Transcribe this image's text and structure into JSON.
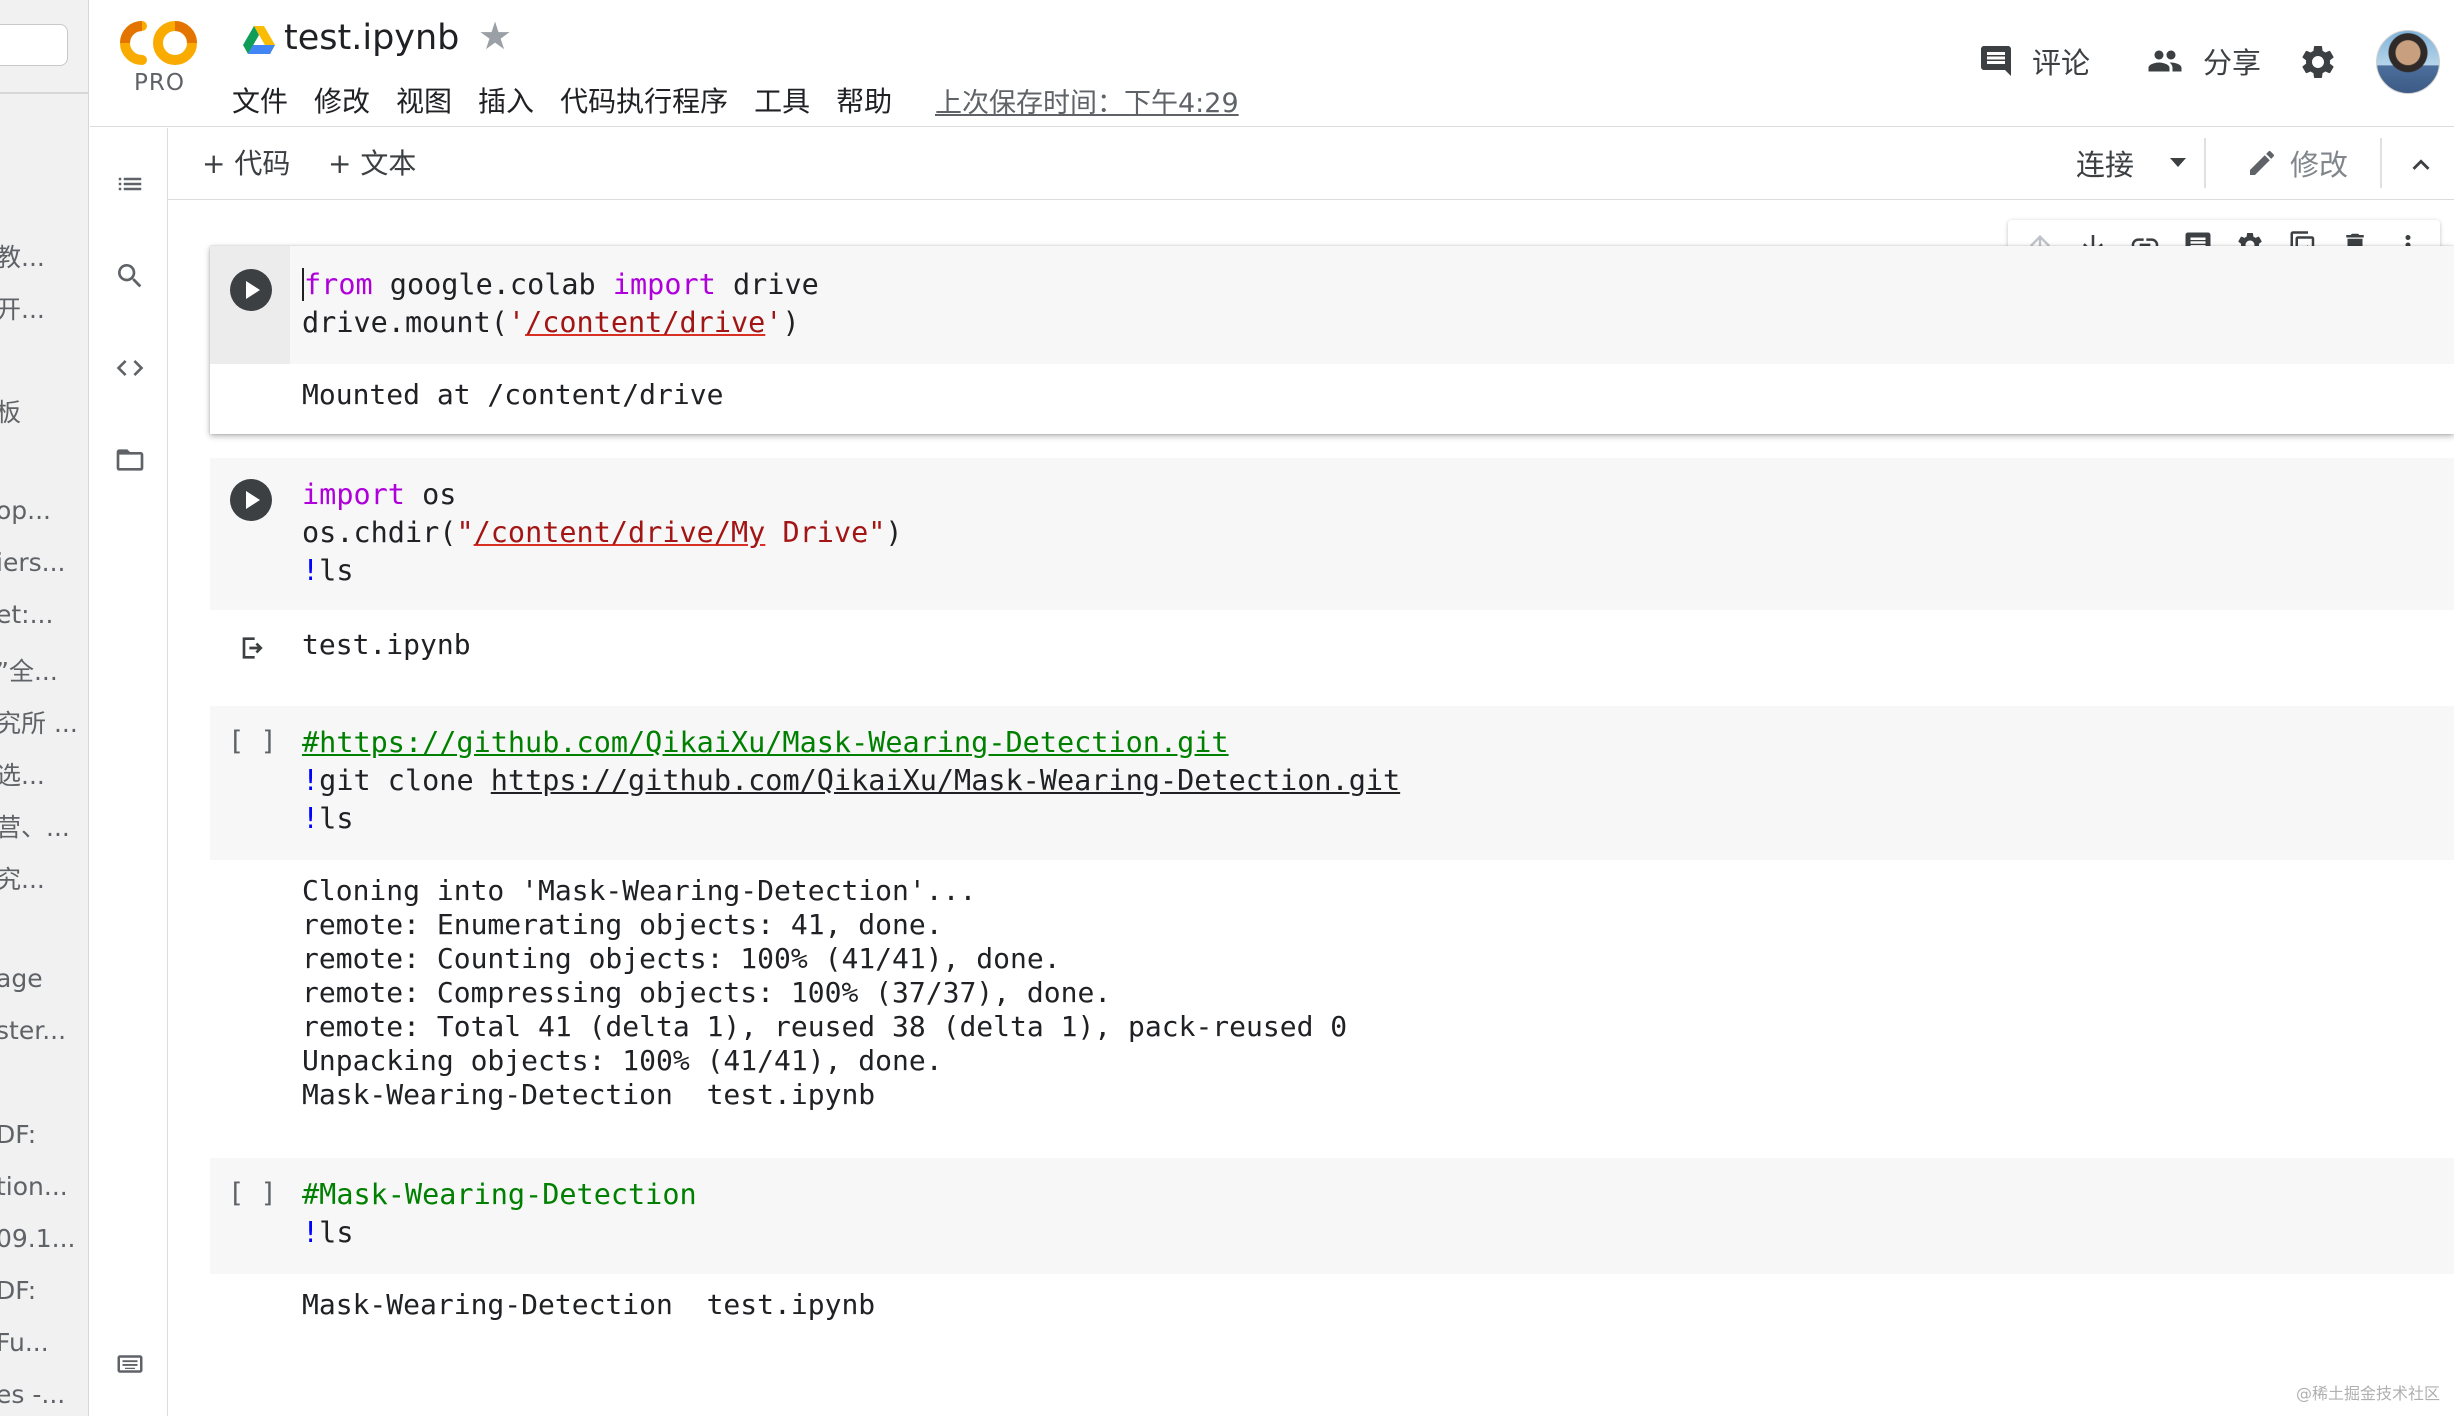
{
  "left_strip": {
    "items": [
      "教...",
      "开...",
      "板",
      "op...",
      "iers...",
      "et:...",
      "”全...",
      "究所 ...",
      "选...",
      "营、...",
      "究...",
      "age",
      "ster...",
      "DF:",
      "tion...",
      "09.1...",
      "DF:",
      "Fu...",
      "es -..."
    ]
  },
  "header": {
    "logo_text": "CO",
    "logo_badge": "PRO",
    "doc_title": "test.ipynb",
    "menu": [
      "文件",
      "修改",
      "视图",
      "插入",
      "代码执行程序",
      "工具",
      "帮助"
    ],
    "last_saved": "上次保存时间：下午4:29",
    "comment_label": "评论",
    "share_label": "分享"
  },
  "toolbar": {
    "add_code": "+ 代码",
    "add_text": "+ 文本",
    "connect": "连接",
    "edit": "修改"
  },
  "cells": [
    {
      "type": "code",
      "exec_state": "run-button",
      "output": "Mounted at /content/drive"
    },
    {
      "type": "code",
      "exec_state": "run-button",
      "output": "test.ipynb"
    },
    {
      "type": "code",
      "exec_state": "[ ]",
      "output": "Cloning into 'Mask-Wearing-Detection'...\nremote: Enumerating objects: 41, done.\nremote: Counting objects: 100% (41/41), done.\nremote: Compressing objects: 100% (37/37), done.\nremote: Total 41 (delta 1), reused 38 (delta 1), pack-reused 0\nUnpacking objects: 100% (41/41), done.\nMask-Wearing-Detection  test.ipynb"
    },
    {
      "type": "code",
      "exec_state": "[ ]",
      "output": "Mask-Wearing-Detection  test.ipynb"
    }
  ],
  "code": {
    "c1_l1_kw1": "from",
    "c1_l1_mid": " google.colab ",
    "c1_l1_kw2": "import",
    "c1_l1_end": " drive",
    "c1_l2_pre": "drive.mount(",
    "c1_l2_q1": "'",
    "c1_l2_str": "/content/drive",
    "c1_l2_q2": "'",
    "c1_l2_post": ")",
    "c2_l1_kw": "import",
    "c2_l1_end": " os",
    "c2_l2_pre": "os.chdir(",
    "c2_l2_q1": "\"",
    "c2_l2_str": "/content/drive/My",
    "c2_l2_str2": " Drive\"",
    "c2_l2_post": ")",
    "c2_l3_bang": "!",
    "c2_l3_cmd": "ls",
    "c3_l1": "#https://github.com/QikaiXu/Mask-Wearing-Detection.git",
    "c3_l2_bang": "!",
    "c3_l2_cmd": "git clone ",
    "c3_l2_url": "https://github.com/QikaiXu/Mask-Wearing-Detection.git",
    "c3_l3_bang": "!",
    "c3_l3_cmd": "ls",
    "c4_l1": "#Mask-Wearing-Detection",
    "c4_l2_bang": "!",
    "c4_l2_cmd": "ls"
  },
  "watermark": "@稀土掘金技术社区",
  "colors": {
    "keyword": "#af00db",
    "string": "#a31515",
    "comment": "#008000",
    "bang": "#0000ff",
    "logo_orange": "#f9ab00",
    "logo_orange_dark": "#e37400"
  }
}
